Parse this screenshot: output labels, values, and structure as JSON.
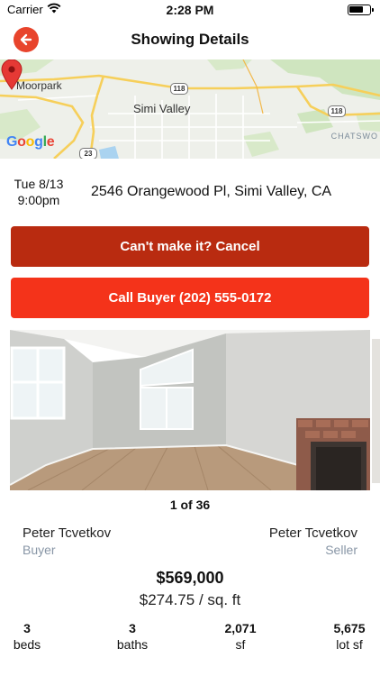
{
  "status_bar": {
    "carrier": "Carrier",
    "time": "2:28 PM"
  },
  "nav": {
    "title": "Showing Details",
    "back_icon": "arrow-left-icon"
  },
  "map": {
    "labels": {
      "moorpark": "Moorpark",
      "simi_valley": "Simi Valley",
      "chatsworth": "CHATSWO"
    },
    "shields": {
      "route_118_a": "118",
      "route_118_b": "118",
      "route_23": "23"
    },
    "attribution": "Google"
  },
  "showing": {
    "date": "Tue 8/13",
    "time": "9:00pm",
    "address": "2546 Orangewood Pl, Simi Valley, CA"
  },
  "actions": {
    "cancel_label": "Can't make it? Cancel",
    "call_label": "Call Buyer (202) 555-0172"
  },
  "photos": {
    "counter": "1 of 36"
  },
  "parties": {
    "buyer_name": "Peter Tcvetkov",
    "buyer_role": "Buyer",
    "seller_name": "Peter Tcvetkov",
    "seller_role": "Seller"
  },
  "listing": {
    "price": "$569,000",
    "price_per_sqft": "$274.75 / sq. ft",
    "stats": {
      "beds_value": "3",
      "beds_label": "beds",
      "baths_value": "3",
      "baths_label": "baths",
      "sf_value": "2,071",
      "sf_label": "sf",
      "lot_value": "5,675",
      "lot_label": "lot sf"
    }
  },
  "colors": {
    "accent": "#e8442c",
    "cancel_button": "#b92b10",
    "call_button": "#f4331a",
    "role_text": "#8896a6"
  }
}
